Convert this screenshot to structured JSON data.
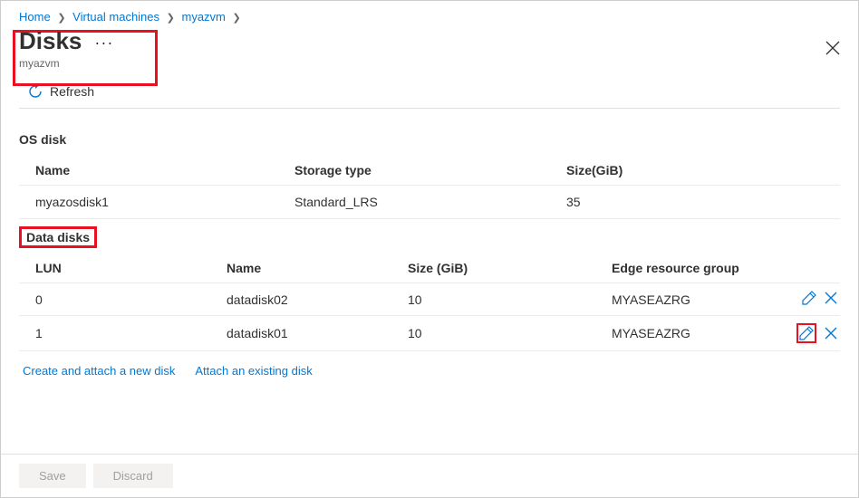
{
  "breadcrumb": {
    "home": "Home",
    "vm": "Virtual machines",
    "name": "myazvm"
  },
  "header": {
    "title": "Disks",
    "subtitle": "myazvm",
    "refresh": "Refresh"
  },
  "osSection": {
    "title": "OS disk",
    "cols": {
      "name": "Name",
      "storage": "Storage type",
      "size": "Size(GiB)"
    },
    "row": {
      "name": "myazosdisk1",
      "storage": "Standard_LRS",
      "size": "35"
    }
  },
  "ddSection": {
    "title": "Data disks",
    "cols": {
      "lun": "LUN",
      "name": "Name",
      "size": "Size (GiB)",
      "rg": "Edge resource group"
    },
    "rows": [
      {
        "lun": "0",
        "name": "datadisk02",
        "size": "10",
        "rg": "MYASEAZRG"
      },
      {
        "lun": "1",
        "name": "datadisk01",
        "size": "10",
        "rg": "MYASEAZRG"
      }
    ]
  },
  "links": {
    "create": "Create and attach a new disk",
    "attach": "Attach an existing disk"
  },
  "footer": {
    "save": "Save",
    "discard": "Discard"
  }
}
